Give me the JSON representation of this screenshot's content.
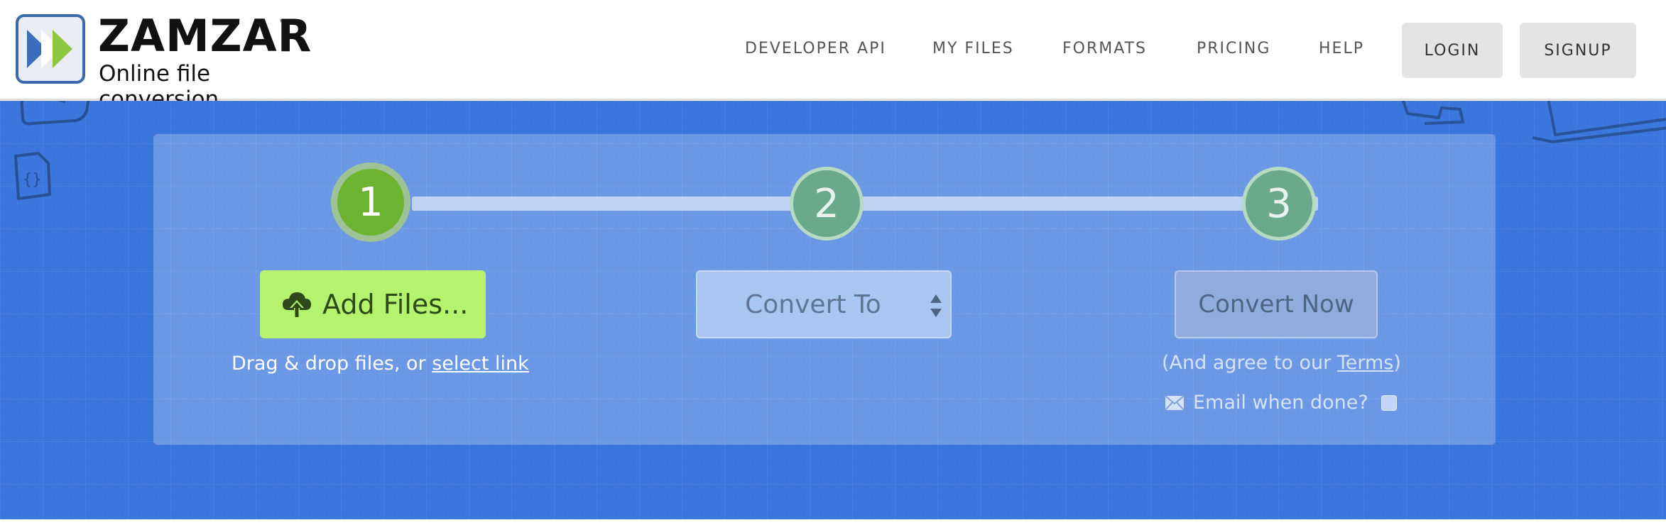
{
  "header": {
    "brand": "ZAMZAR",
    "trademark": "™",
    "tagline": "Online file conversion",
    "nav": [
      {
        "label": "DEVELOPER API",
        "name": "nav-developer-api"
      },
      {
        "label": "MY FILES",
        "name": "nav-my-files"
      },
      {
        "label": "FORMATS",
        "name": "nav-formats"
      },
      {
        "label": "PRICING",
        "name": "nav-pricing"
      },
      {
        "label": "HELP",
        "name": "nav-help"
      }
    ],
    "login_label": "LOGIN",
    "signup_label": "SIGNUP"
  },
  "steps": {
    "step1": "1",
    "step2": "2",
    "step3": "3"
  },
  "step1": {
    "button_label": "Add Files...",
    "helper_prefix": "Drag & drop files, or ",
    "helper_link": "select link"
  },
  "step2": {
    "select_label": "Convert To"
  },
  "step3": {
    "button_label": "Convert Now",
    "agree_prefix": "(And agree to our ",
    "agree_link": "Terms",
    "agree_suffix": ")",
    "email_label": "Email when done?",
    "email_checked": false
  },
  "icons": {
    "logo": "zamzar-chevron-logo",
    "upload": "cloud-upload-icon",
    "select_arrows": "sort-arrows-icon",
    "email": "envelope-icon"
  },
  "colors": {
    "hero_background": "#3a76dc",
    "step_active": "#6cb330",
    "add_button": "#b5f36e",
    "step_inactive": "#6aa98c"
  }
}
